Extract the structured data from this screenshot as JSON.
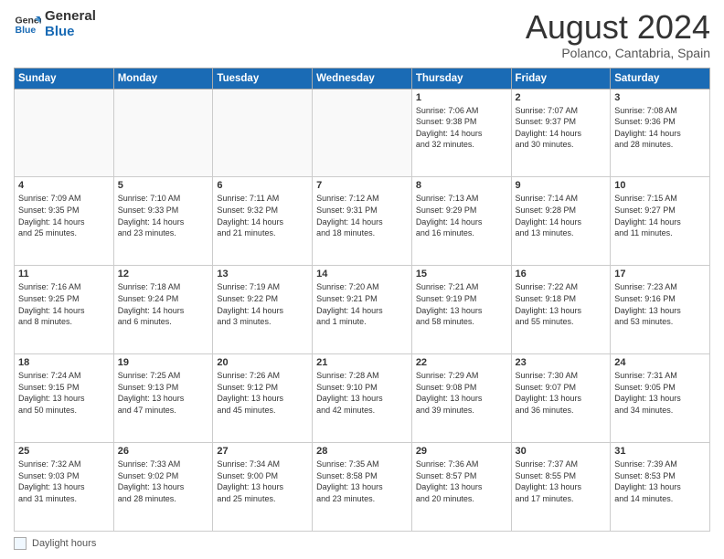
{
  "logo": {
    "line1": "General",
    "line2": "Blue"
  },
  "title": "August 2024",
  "subtitle": "Polanco, Cantabria, Spain",
  "weekdays": [
    "Sunday",
    "Monday",
    "Tuesday",
    "Wednesday",
    "Thursday",
    "Friday",
    "Saturday"
  ],
  "footer_legend": "Daylight hours",
  "weeks": [
    [
      {
        "day": "",
        "info": ""
      },
      {
        "day": "",
        "info": ""
      },
      {
        "day": "",
        "info": ""
      },
      {
        "day": "",
        "info": ""
      },
      {
        "day": "1",
        "info": "Sunrise: 7:06 AM\nSunset: 9:38 PM\nDaylight: 14 hours\nand 32 minutes."
      },
      {
        "day": "2",
        "info": "Sunrise: 7:07 AM\nSunset: 9:37 PM\nDaylight: 14 hours\nand 30 minutes."
      },
      {
        "day": "3",
        "info": "Sunrise: 7:08 AM\nSunset: 9:36 PM\nDaylight: 14 hours\nand 28 minutes."
      }
    ],
    [
      {
        "day": "4",
        "info": "Sunrise: 7:09 AM\nSunset: 9:35 PM\nDaylight: 14 hours\nand 25 minutes."
      },
      {
        "day": "5",
        "info": "Sunrise: 7:10 AM\nSunset: 9:33 PM\nDaylight: 14 hours\nand 23 minutes."
      },
      {
        "day": "6",
        "info": "Sunrise: 7:11 AM\nSunset: 9:32 PM\nDaylight: 14 hours\nand 21 minutes."
      },
      {
        "day": "7",
        "info": "Sunrise: 7:12 AM\nSunset: 9:31 PM\nDaylight: 14 hours\nand 18 minutes."
      },
      {
        "day": "8",
        "info": "Sunrise: 7:13 AM\nSunset: 9:29 PM\nDaylight: 14 hours\nand 16 minutes."
      },
      {
        "day": "9",
        "info": "Sunrise: 7:14 AM\nSunset: 9:28 PM\nDaylight: 14 hours\nand 13 minutes."
      },
      {
        "day": "10",
        "info": "Sunrise: 7:15 AM\nSunset: 9:27 PM\nDaylight: 14 hours\nand 11 minutes."
      }
    ],
    [
      {
        "day": "11",
        "info": "Sunrise: 7:16 AM\nSunset: 9:25 PM\nDaylight: 14 hours\nand 8 minutes."
      },
      {
        "day": "12",
        "info": "Sunrise: 7:18 AM\nSunset: 9:24 PM\nDaylight: 14 hours\nand 6 minutes."
      },
      {
        "day": "13",
        "info": "Sunrise: 7:19 AM\nSunset: 9:22 PM\nDaylight: 14 hours\nand 3 minutes."
      },
      {
        "day": "14",
        "info": "Sunrise: 7:20 AM\nSunset: 9:21 PM\nDaylight: 14 hours\nand 1 minute."
      },
      {
        "day": "15",
        "info": "Sunrise: 7:21 AM\nSunset: 9:19 PM\nDaylight: 13 hours\nand 58 minutes."
      },
      {
        "day": "16",
        "info": "Sunrise: 7:22 AM\nSunset: 9:18 PM\nDaylight: 13 hours\nand 55 minutes."
      },
      {
        "day": "17",
        "info": "Sunrise: 7:23 AM\nSunset: 9:16 PM\nDaylight: 13 hours\nand 53 minutes."
      }
    ],
    [
      {
        "day": "18",
        "info": "Sunrise: 7:24 AM\nSunset: 9:15 PM\nDaylight: 13 hours\nand 50 minutes."
      },
      {
        "day": "19",
        "info": "Sunrise: 7:25 AM\nSunset: 9:13 PM\nDaylight: 13 hours\nand 47 minutes."
      },
      {
        "day": "20",
        "info": "Sunrise: 7:26 AM\nSunset: 9:12 PM\nDaylight: 13 hours\nand 45 minutes."
      },
      {
        "day": "21",
        "info": "Sunrise: 7:28 AM\nSunset: 9:10 PM\nDaylight: 13 hours\nand 42 minutes."
      },
      {
        "day": "22",
        "info": "Sunrise: 7:29 AM\nSunset: 9:08 PM\nDaylight: 13 hours\nand 39 minutes."
      },
      {
        "day": "23",
        "info": "Sunrise: 7:30 AM\nSunset: 9:07 PM\nDaylight: 13 hours\nand 36 minutes."
      },
      {
        "day": "24",
        "info": "Sunrise: 7:31 AM\nSunset: 9:05 PM\nDaylight: 13 hours\nand 34 minutes."
      }
    ],
    [
      {
        "day": "25",
        "info": "Sunrise: 7:32 AM\nSunset: 9:03 PM\nDaylight: 13 hours\nand 31 minutes."
      },
      {
        "day": "26",
        "info": "Sunrise: 7:33 AM\nSunset: 9:02 PM\nDaylight: 13 hours\nand 28 minutes."
      },
      {
        "day": "27",
        "info": "Sunrise: 7:34 AM\nSunset: 9:00 PM\nDaylight: 13 hours\nand 25 minutes."
      },
      {
        "day": "28",
        "info": "Sunrise: 7:35 AM\nSunset: 8:58 PM\nDaylight: 13 hours\nand 23 minutes."
      },
      {
        "day": "29",
        "info": "Sunrise: 7:36 AM\nSunset: 8:57 PM\nDaylight: 13 hours\nand 20 minutes."
      },
      {
        "day": "30",
        "info": "Sunrise: 7:37 AM\nSunset: 8:55 PM\nDaylight: 13 hours\nand 17 minutes."
      },
      {
        "day": "31",
        "info": "Sunrise: 7:39 AM\nSunset: 8:53 PM\nDaylight: 13 hours\nand 14 minutes."
      }
    ]
  ]
}
